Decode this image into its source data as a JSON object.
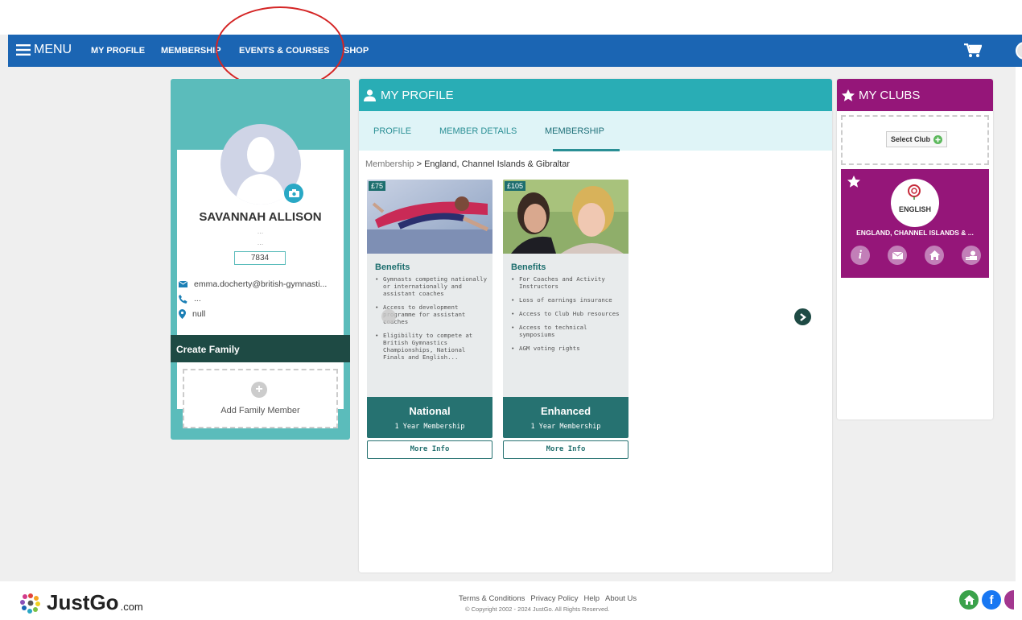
{
  "nav": {
    "menu_label": "MENU",
    "links": [
      "MY PROFILE",
      "MEMBERSHIP",
      "EVENTS & COURSES",
      "SHOP"
    ]
  },
  "profile": {
    "name": "SAVANNAH ALLISON",
    "line1": "...",
    "line2": "...",
    "member_id": "7834",
    "email": "emma.docherty@british-gymnasti...",
    "phone": "...",
    "location": "null",
    "create_family": "Create Family",
    "add_family_member": "Add Family Member"
  },
  "center": {
    "title": "MY PROFILE",
    "tabs": [
      "PROFILE",
      "MEMBER DETAILS",
      "MEMBERSHIP"
    ],
    "active_tab": "MEMBERSHIP",
    "breadcrumb_root": "Membership",
    "breadcrumb_sep": ">",
    "breadcrumb_current": "England, Channel Islands & Gibraltar",
    "memberships": [
      {
        "price": "£75",
        "benefits_title": "Benefits",
        "benefits": [
          "Gymnasts competing nationally or internationally and assistant coaches",
          "Access to development programme for assistant coaches",
          "Eligibility to compete at British Gymnastics Championships, National Finals and English..."
        ],
        "name": "National",
        "duration": "1 Year Membership",
        "more_info": "More Info"
      },
      {
        "price": "£105",
        "benefits_title": "Benefits",
        "benefits": [
          "For Coaches and Activity Instructors",
          "Loss of earnings insurance",
          "Access to Club Hub resources",
          "Access to technical symposiums",
          "AGM voting rights"
        ],
        "name": "Enhanced",
        "duration": "1 Year Membership",
        "more_info": "More Info"
      }
    ]
  },
  "clubs": {
    "title": "MY CLUBS",
    "select_club": "Select Club",
    "club_name": "ENGLAND, CHANNEL ISLANDS & ...",
    "club_logo_text": "ENGLISH"
  },
  "footer": {
    "brand": "JustGo",
    "brand_suffix": ".com",
    "links": [
      "Terms & Conditions",
      "Privacy Policy",
      "Help",
      "About Us"
    ],
    "copyright": "© Copyright 2002 - 2024 JustGo. All Rights Reserved."
  },
  "colors": {
    "nav": "#1b65b3",
    "teal": "#29adb5",
    "dark_teal": "#1e4a44",
    "club_purple": "#951679",
    "annotation_red": "#d42525"
  }
}
